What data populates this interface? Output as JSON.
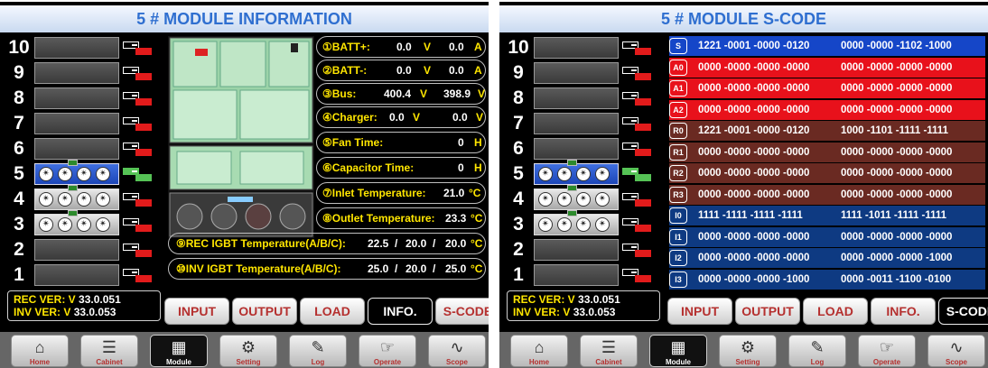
{
  "left_title": "5 # MODULE INFORMATION",
  "right_title": "5 # MODULE S-CODE",
  "slots": [
    "10",
    "9",
    "8",
    "7",
    "6",
    "5",
    "4",
    "3",
    "2",
    "1"
  ],
  "version": {
    "rec": "REC VER: V",
    "rec_val": "33.0.051",
    "inv": "INV VER: V",
    "inv_val": "33.0.053"
  },
  "tabs": [
    "INPUT",
    "OUTPUT",
    "LOAD",
    "INFO.",
    "S-CODE"
  ],
  "nav": [
    "Home",
    "Cabinet",
    "Module",
    "Setting",
    "Log",
    "Operate",
    "Scope"
  ],
  "info": {
    "batt_pos": {
      "label": "①BATT+:",
      "v1": "0.0",
      "u1": "V",
      "v2": "0.0",
      "u2": "A"
    },
    "batt_neg": {
      "label": "②BATT-:",
      "v1": "0.0",
      "u1": "V",
      "v2": "0.0",
      "u2": "A"
    },
    "bus": {
      "label": "③Bus:",
      "v1": "400.4",
      "u1": "V",
      "v2": "398.9",
      "u2": "V"
    },
    "charger": {
      "label": "④Charger:",
      "v1": "0.0",
      "u1": "V",
      "v2": "0.0",
      "u2": "V"
    },
    "fan": {
      "label": "⑤Fan Time:",
      "v": "0",
      "u": "H"
    },
    "cap": {
      "label": "⑥Capacitor Time:",
      "v": "0",
      "u": "H"
    },
    "inlet": {
      "label": "⑦Inlet Temperature:",
      "v": "21.0",
      "u": "°C"
    },
    "outlet": {
      "label": "⑧Outlet Temperature:",
      "v": "23.3",
      "u": "°C"
    },
    "rec_igbt": {
      "label": "⑨REC IGBT Temperature(A/B/C):",
      "a": "22.5",
      "b": "20.0",
      "c": "20.0",
      "u": "°C"
    },
    "inv_igbt": {
      "label": "⑩INV IGBT Temperature(A/B/C):",
      "a": "25.0",
      "b": "20.0",
      "c": "25.0",
      "u": "°C"
    }
  },
  "scode": [
    {
      "tag": "S",
      "v1": "1221 -0001 -0000 -0120",
      "v2": "0000 -0000 -1102 -1000",
      "color": "#1546c8"
    },
    {
      "tag": "A0",
      "v1": "0000 -0000 -0000 -0000",
      "v2": "0000 -0000 -0000 -0000",
      "color": "#e8111b"
    },
    {
      "tag": "A1",
      "v1": "0000 -0000 -0000 -0000",
      "v2": "0000 -0000 -0000 -0000",
      "color": "#e8111b"
    },
    {
      "tag": "A2",
      "v1": "0000 -0000 -0000 -0000",
      "v2": "0000 -0000 -0000 -0000",
      "color": "#e8111b"
    },
    {
      "tag": "R0",
      "v1": "1221 -0001 -0000 -0120",
      "v2": "1000 -1101 -1111 -1111",
      "color": "#6a2a22"
    },
    {
      "tag": "R1",
      "v1": "0000 -0000 -0000 -0000",
      "v2": "0000 -0000 -0000 -0000",
      "color": "#6a2a22"
    },
    {
      "tag": "R2",
      "v1": "0000 -0000 -0000 -0000",
      "v2": "0000 -0000 -0000 -0000",
      "color": "#6a2a22"
    },
    {
      "tag": "R3",
      "v1": "0000 -0000 -0000 -0000",
      "v2": "0000 -0000 -0000 -0000",
      "color": "#6a2a22"
    },
    {
      "tag": "I0",
      "v1": "1111 -1111 -1111 -1111",
      "v2": "1111 -1011 -1111 -1111",
      "color": "#0e3a82"
    },
    {
      "tag": "I1",
      "v1": "0000 -0000 -0000 -0000",
      "v2": "0000 -0000 -0000 -0000",
      "color": "#0e3a82"
    },
    {
      "tag": "I2",
      "v1": "0000 -0000 -0000 -0000",
      "v2": "0000 -0000 -0000 -1000",
      "color": "#0e3a82"
    },
    {
      "tag": "I3",
      "v1": "0000 -0000 -0000 -1000",
      "v2": "0000 -0011 -1100 -0100",
      "color": "#0e3a82"
    }
  ]
}
